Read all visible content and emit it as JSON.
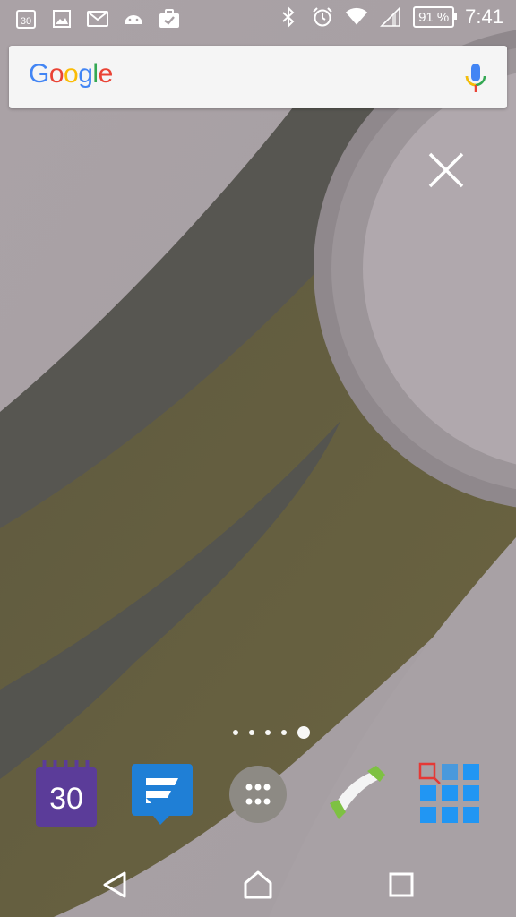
{
  "statusbar": {
    "time": "7:41",
    "battery_percent": "91 %",
    "calendar_day": "30",
    "left_icons": [
      "calendar-icon",
      "gallery-icon",
      "gmail-icon",
      "android-update-icon",
      "briefcase-check-icon"
    ],
    "right_icons": [
      "bluetooth-icon",
      "alarm-icon",
      "wifi-icon",
      "cell-signal-icon",
      "battery-icon"
    ]
  },
  "search": {
    "brand": "Google",
    "brand_letters": [
      {
        "char": "G",
        "color": "#4285F4"
      },
      {
        "char": "o",
        "color": "#EA4335"
      },
      {
        "char": "o",
        "color": "#FBBC05"
      },
      {
        "char": "g",
        "color": "#4285F4"
      },
      {
        "char": "l",
        "color": "#34A853"
      },
      {
        "char": "e",
        "color": "#EA4335"
      }
    ],
    "voice_icon": "microphone-icon"
  },
  "overlay": {
    "close_icon": "close-icon"
  },
  "pages": {
    "count": 5,
    "active_index": 4
  },
  "dock": {
    "items": [
      {
        "name": "calendar-app",
        "icon": "calendar-app-icon",
        "label": "30",
        "color": "#5b3c99"
      },
      {
        "name": "messaging-app",
        "icon": "messaging-app-icon",
        "color": "#1f7fd6"
      },
      {
        "name": "app-drawer",
        "icon": "app-drawer-icon"
      },
      {
        "name": "phone-app",
        "icon": "phone-app-icon",
        "color": "#7ec142"
      },
      {
        "name": "tiles-app",
        "icon": "tiles-app-icon",
        "color": "#2196f3"
      }
    ]
  },
  "navbar": {
    "back_icon": "back-icon",
    "home_icon": "home-icon",
    "recents_icon": "recents-icon"
  },
  "colors": {
    "wallpaper_bg": "#a8a0a4",
    "wallpaper_dark_band": "#565650",
    "wallpaper_olive_band": "#666040",
    "ring": "#8e878b"
  }
}
